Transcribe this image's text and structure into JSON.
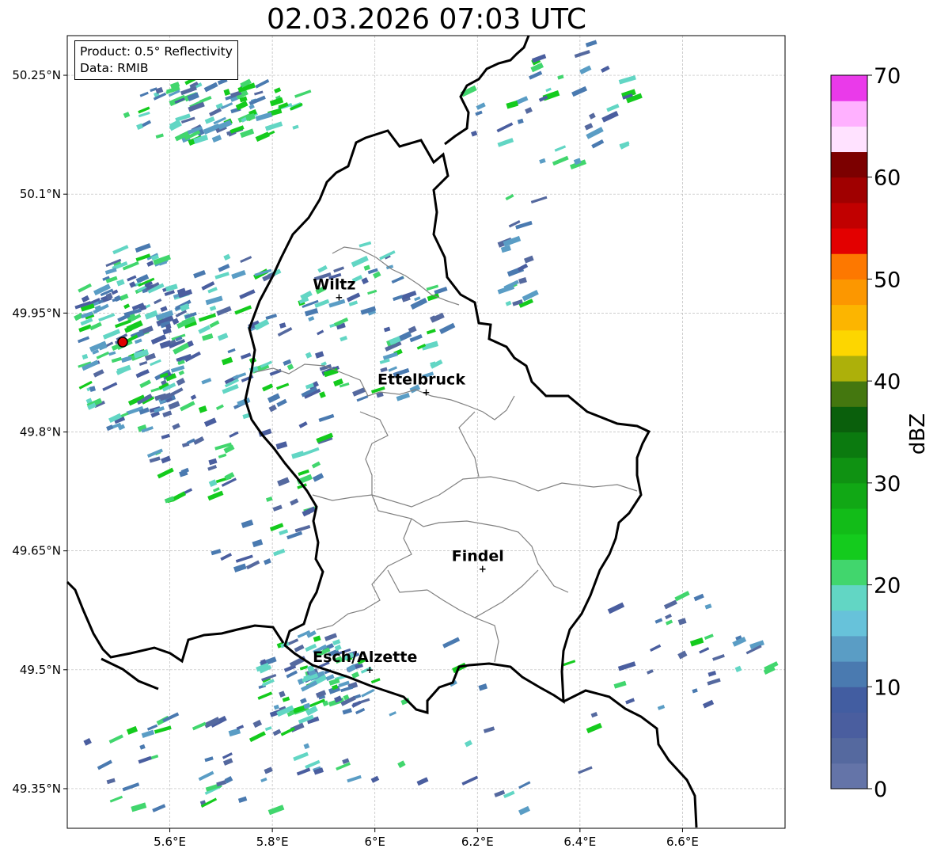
{
  "title": "02.03.2026 07:03 UTC",
  "info_box": {
    "product": "Product: 0.5° Reflectivity",
    "data": "Data: RMIB"
  },
  "map": {
    "lon_range": [
      5.4,
      6.8
    ],
    "lat_range": [
      49.3,
      50.3
    ],
    "x_ticks": [
      "5.6°E",
      "5.8°E",
      "6°E",
      "6.2°E",
      "6.4°E",
      "6.6°E"
    ],
    "x_tick_values": [
      5.6,
      5.8,
      6.0,
      6.2,
      6.4,
      6.6
    ],
    "y_ticks": [
      "49.35°N",
      "49.5°N",
      "49.65°N",
      "49.8°N",
      "49.95°N",
      "50.1°N",
      "50.25°N"
    ],
    "y_tick_values": [
      49.35,
      49.5,
      49.65,
      49.8,
      49.95,
      50.1,
      50.25
    ],
    "grid": true,
    "cities": [
      {
        "name": "Wiltz",
        "lon": 5.93,
        "lat": 49.97
      },
      {
        "name": "Ettelbruck",
        "lon": 6.1,
        "lat": 49.85
      },
      {
        "name": "Findel",
        "lon": 6.21,
        "lat": 49.627
      },
      {
        "name": "Esch/Alzette",
        "lon": 5.99,
        "lat": 49.5
      }
    ],
    "radar_site": {
      "lon": 5.505,
      "lat": 49.915
    }
  },
  "colorbar": {
    "label": "dBZ",
    "ticks": [
      "0",
      "10",
      "20",
      "30",
      "40",
      "50",
      "60",
      "70"
    ],
    "min": 0,
    "max": 70,
    "step": 2.5,
    "colors": [
      "#6474a8",
      "#55699f",
      "#4a5e9f",
      "#425da1",
      "#4a7ab0",
      "#5a9dc5",
      "#67c2da",
      "#62d6c4",
      "#41d66d",
      "#14cb1d",
      "#12bc18",
      "#11a815",
      "#0f9212",
      "#0b7a0f",
      "#0a5f0c",
      "#44770f",
      "#adb00a",
      "#fdd600",
      "#fcb500",
      "#fc9700",
      "#fd7800",
      "#e30000",
      "#c10000",
      "#a00000",
      "#7c0000",
      "#ffe2ff",
      "#ffb1ff",
      "#ff72ff",
      "#ea3aea"
    ]
  }
}
